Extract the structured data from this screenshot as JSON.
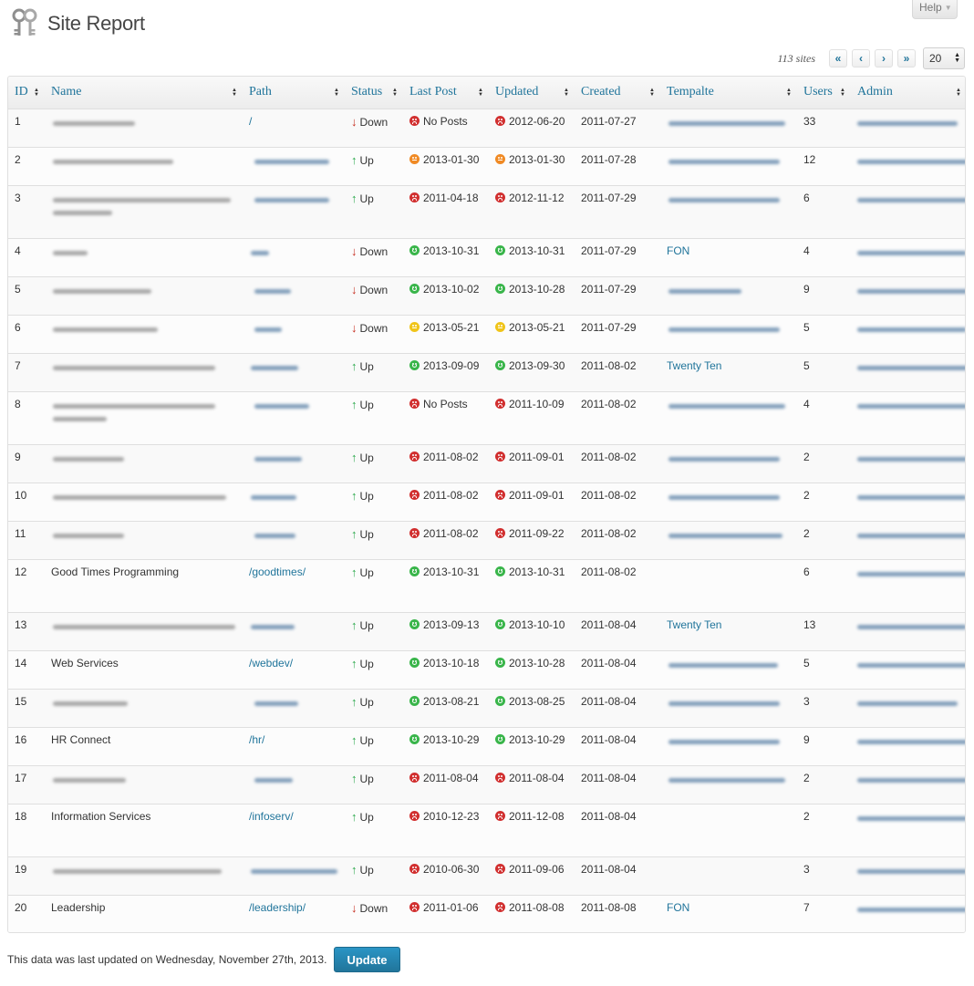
{
  "header": {
    "title": "Site Report",
    "help_label": "Help"
  },
  "pagination": {
    "count_text": "113 sites",
    "first": "«",
    "prev": "‹",
    "next": "›",
    "last": "»",
    "per_page": "20"
  },
  "columns": [
    "ID",
    "Name",
    "Path",
    "Status",
    "Last Post",
    "Updated",
    "Created",
    "Tempalte",
    "Users",
    "Admin"
  ],
  "rows": [
    {
      "id": "1",
      "name": "",
      "path": "/",
      "status": "Down",
      "last_post": "No Posts",
      "last_post_health": "bad",
      "updated": "2012-06-20",
      "updated_health": "bad",
      "created": "2011-07-27",
      "template": "",
      "users": "33"
    },
    {
      "id": "2",
      "name": "",
      "path": "",
      "status": "Up",
      "last_post": "2013-01-30",
      "last_post_health": "mid",
      "updated": "2013-01-30",
      "updated_health": "mid",
      "created": "2011-07-28",
      "template": "",
      "users": "12"
    },
    {
      "id": "3",
      "name": "",
      "path": "",
      "status": "Up",
      "last_post": "2011-04-18",
      "last_post_health": "bad",
      "updated": "2012-11-12",
      "updated_health": "bad",
      "created": "2011-07-29",
      "template": "",
      "users": "6"
    },
    {
      "id": "4",
      "name": "",
      "path": "",
      "status": "Down",
      "last_post": "2013-10-31",
      "last_post_health": "good",
      "updated": "2013-10-31",
      "updated_health": "good",
      "created": "2011-07-29",
      "template": "FON",
      "users": "4"
    },
    {
      "id": "5",
      "name": "",
      "path": "",
      "status": "Down",
      "last_post": "2013-10-02",
      "last_post_health": "good",
      "updated": "2013-10-28",
      "updated_health": "good",
      "created": "2011-07-29",
      "template": "",
      "users": "9"
    },
    {
      "id": "6",
      "name": "",
      "path": "",
      "status": "Down",
      "last_post": "2013-05-21",
      "last_post_health": "warn",
      "updated": "2013-05-21",
      "updated_health": "warn",
      "created": "2011-07-29",
      "template": "",
      "users": "5"
    },
    {
      "id": "7",
      "name": "",
      "path": "",
      "status": "Up",
      "last_post": "2013-09-09",
      "last_post_health": "good",
      "updated": "2013-09-30",
      "updated_health": "good",
      "created": "2011-08-02",
      "template": "Twenty Ten",
      "users": "5"
    },
    {
      "id": "8",
      "name": "",
      "path": "",
      "status": "Up",
      "last_post": "No Posts",
      "last_post_health": "bad",
      "updated": "2011-10-09",
      "updated_health": "bad",
      "created": "2011-08-02",
      "template": "",
      "users": "4"
    },
    {
      "id": "9",
      "name": "",
      "path": "",
      "status": "Up",
      "last_post": "2011-08-02",
      "last_post_health": "bad",
      "updated": "2011-09-01",
      "updated_health": "bad",
      "created": "2011-08-02",
      "template": "",
      "users": "2"
    },
    {
      "id": "10",
      "name": "",
      "path": "",
      "status": "Up",
      "last_post": "2011-08-02",
      "last_post_health": "bad",
      "updated": "2011-09-01",
      "updated_health": "bad",
      "created": "2011-08-02",
      "template": "",
      "users": "2"
    },
    {
      "id": "11",
      "name": "",
      "path": "",
      "status": "Up",
      "last_post": "2011-08-02",
      "last_post_health": "bad",
      "updated": "2011-09-22",
      "updated_health": "bad",
      "created": "2011-08-02",
      "template": "",
      "users": "2"
    },
    {
      "id": "12",
      "name": "Good Times Programming",
      "path": "/goodtimes/",
      "status": "Up",
      "last_post": "2013-10-31",
      "last_post_health": "good",
      "updated": "2013-10-31",
      "updated_health": "good",
      "created": "2011-08-02",
      "template": "",
      "users": "6"
    },
    {
      "id": "13",
      "name": "",
      "path": "",
      "status": "Up",
      "last_post": "2013-09-13",
      "last_post_health": "good",
      "updated": "2013-10-10",
      "updated_health": "good",
      "created": "2011-08-04",
      "template": "Twenty Ten",
      "users": "13"
    },
    {
      "id": "14",
      "name": "Web Services",
      "path": "/webdev/",
      "status": "Up",
      "last_post": "2013-10-18",
      "last_post_health": "good",
      "updated": "2013-10-28",
      "updated_health": "good",
      "created": "2011-08-04",
      "template": "",
      "users": "5"
    },
    {
      "id": "15",
      "name": "",
      "path": "",
      "status": "Up",
      "last_post": "2013-08-21",
      "last_post_health": "good",
      "updated": "2013-08-25",
      "updated_health": "good",
      "created": "2011-08-04",
      "template": "",
      "users": "3"
    },
    {
      "id": "16",
      "name": "HR Connect",
      "path": "/hr/",
      "status": "Up",
      "last_post": "2013-10-29",
      "last_post_health": "good",
      "updated": "2013-10-29",
      "updated_health": "good",
      "created": "2011-08-04",
      "template": "",
      "users": "9"
    },
    {
      "id": "17",
      "name": "",
      "path": "",
      "status": "Up",
      "last_post": "2011-08-04",
      "last_post_health": "bad",
      "updated": "2011-08-04",
      "updated_health": "bad",
      "created": "2011-08-04",
      "template": "",
      "users": "2"
    },
    {
      "id": "18",
      "name": "Information Services",
      "path": "/infoserv/",
      "status": "Up",
      "last_post": "2010-12-23",
      "last_post_health": "bad",
      "updated": "2011-12-08",
      "updated_health": "bad",
      "created": "2011-08-04",
      "template": "",
      "users": "2"
    },
    {
      "id": "19",
      "name": "",
      "path": "",
      "status": "Up",
      "last_post": "2010-06-30",
      "last_post_health": "bad",
      "updated": "2011-09-06",
      "updated_health": "bad",
      "created": "2011-08-04",
      "template": "",
      "users": "3"
    },
    {
      "id": "20",
      "name": "Leadership",
      "path": "/leadership/",
      "status": "Down",
      "last_post": "2011-01-06",
      "last_post_health": "bad",
      "updated": "2011-08-08",
      "updated_health": "bad",
      "created": "2011-08-08",
      "template": "FON",
      "users": "7"
    }
  ],
  "footer": {
    "text": "This data was last updated on Wednesday, November 27th, 2013.",
    "update_label": "Update"
  },
  "colors": {
    "link": "#21759b",
    "up": "#2aa84b",
    "down": "#c62d1f",
    "good": "#39b54a",
    "warn": "#f0c419",
    "mid": "#f08a24",
    "bad": "#d12f2f"
  }
}
